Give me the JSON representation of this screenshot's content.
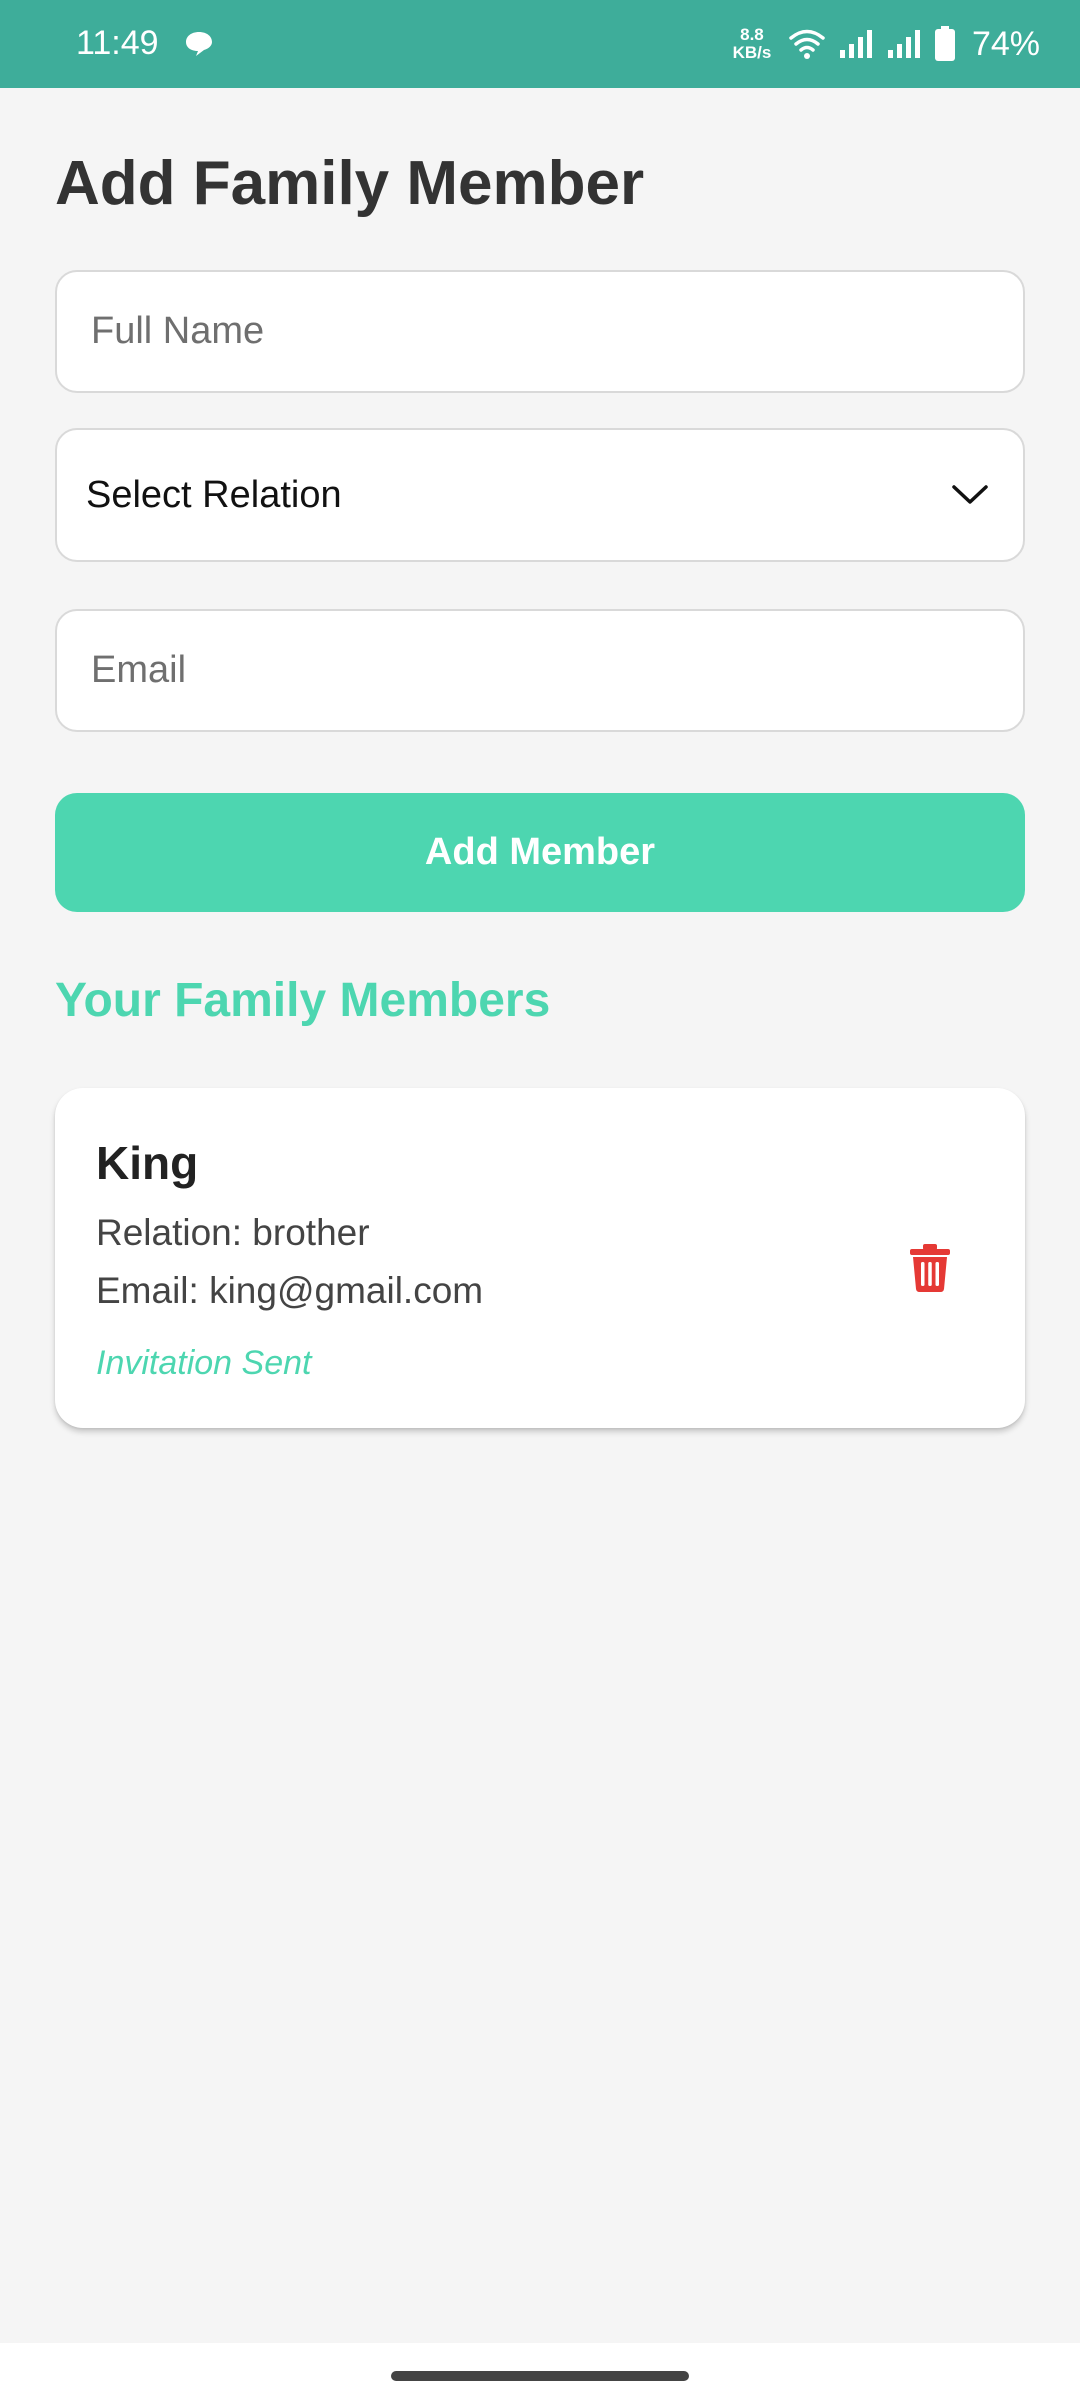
{
  "status_bar": {
    "time": "11:49",
    "net_speed_value": "8.8",
    "net_speed_unit": "KB/s",
    "battery": "74%",
    "icons": [
      "chat-bubble-icon",
      "wifi-icon",
      "signal-icon",
      "signal-icon",
      "battery-icon"
    ]
  },
  "colors": {
    "status_bar": "#3ead9a",
    "accent": "#4dd6b0",
    "delete": "#e53935",
    "background": "#f5f5f5"
  },
  "form": {
    "title": "Add Family Member",
    "full_name_placeholder": "Full Name",
    "full_name_value": "",
    "relation_selected": "Select Relation",
    "email_placeholder": "Email",
    "email_value": "",
    "submit_label": "Add Member"
  },
  "members_section": {
    "title": "Your Family Members",
    "members": [
      {
        "name": "King",
        "relation_text": "Relation: brother",
        "email_text": "Email: king@gmail.com",
        "status": "Invitation Sent",
        "action_icon": "trash-icon"
      }
    ]
  }
}
